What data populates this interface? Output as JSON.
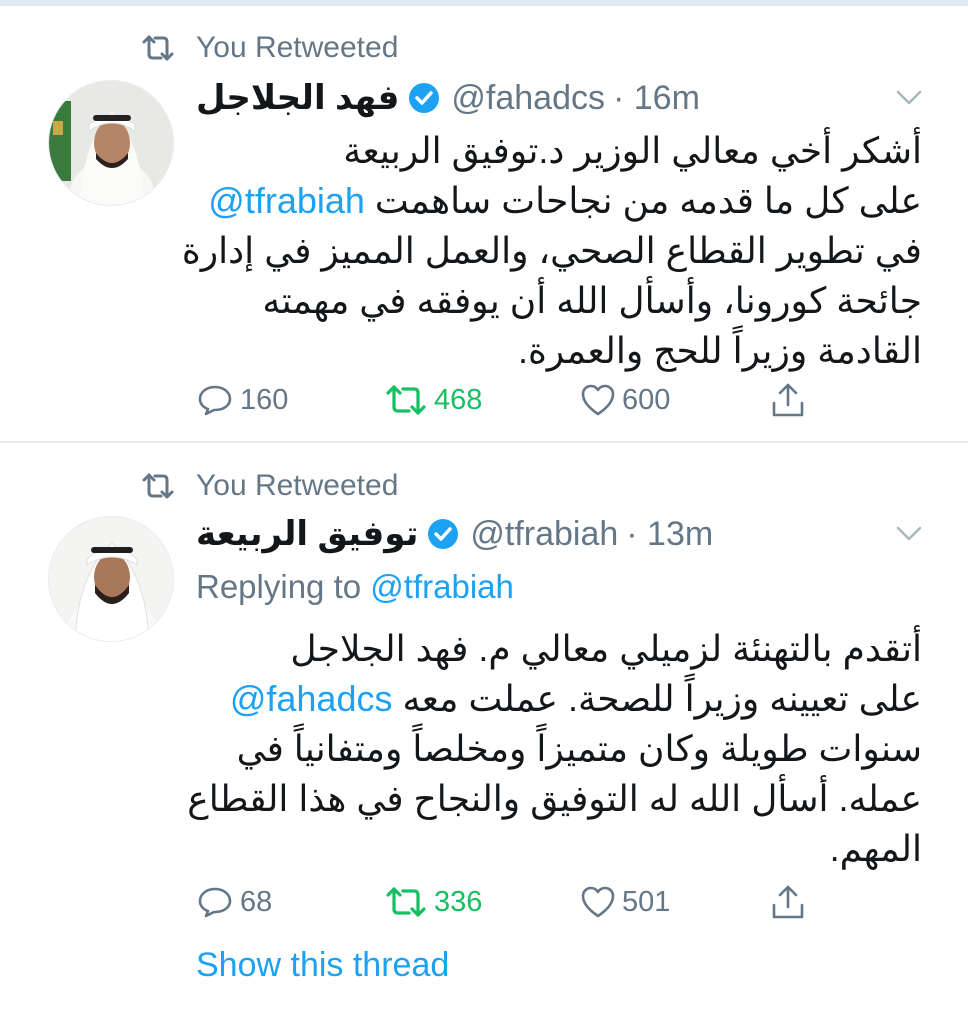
{
  "colors": {
    "link": "#1da1f2",
    "muted": "#657786",
    "retweet_active": "#17bf63",
    "text": "#14171a"
  },
  "tweets": [
    {
      "retweet_label": "You Retweeted",
      "name": "فهد الجلاجل",
      "handle": "@fahadcs",
      "time": "· 16m",
      "avatar_icon": "profile-photo",
      "body": {
        "line1": "أشكر أخي معالي الوزير د.توفيق الربيعة",
        "line2_mention": "@tfrabiah",
        "line2_text": "على كل ما قدمه من نجاحات ساهمت",
        "line3": "في تطوير القطاع الصحي، والعمل المميز في إدارة",
        "line4": "جائحة كورونا، وأسأل الله أن يوفقه في مهمته",
        "line5": "القادمة  وزيراً للحج والعمرة."
      },
      "replies": "160",
      "retweets": "468",
      "likes": "600"
    },
    {
      "retweet_label": "You Retweeted",
      "name": "توفيق الربيعة",
      "handle": "@tfrabiah",
      "time": "· 13m",
      "avatar_icon": "profile-photo",
      "replying_prefix": "Replying to",
      "replying_to": "@tfrabiah",
      "body": {
        "line1": "أتقدم بالتهنئة لزميلي معالي م. فهد الجلاجل",
        "line2_mention": "@fahadcs",
        "line2_text": "على تعيينه وزيراً للصحة.  عملت معه",
        "line3": "سنوات طويلة وكان متميزاً ومخلصاً ومتفانياً في",
        "line4": "عمله.  أسأل الله له التوفيق والنجاح في هذا القطاع",
        "line5": "المهم."
      },
      "replies": "68",
      "retweets": "336",
      "likes": "501",
      "show_thread": "Show this thread"
    }
  ]
}
